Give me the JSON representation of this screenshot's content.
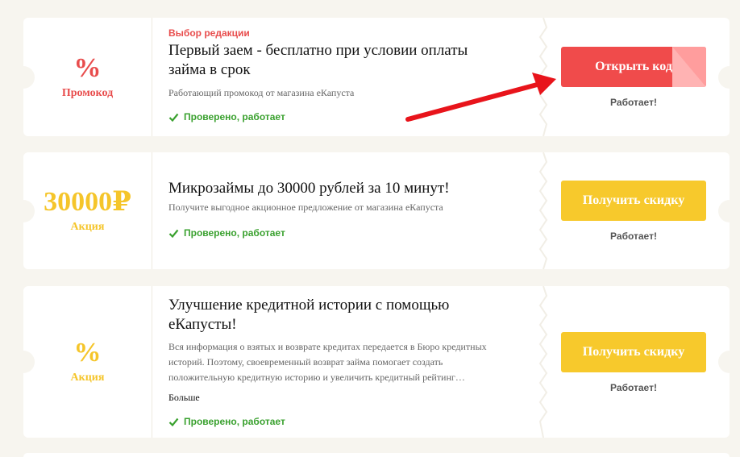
{
  "coupons": [
    {
      "value": "%",
      "kind": "Промокод",
      "badge": "Выбор редакции",
      "title_line1": "Первый заем - бесплатно при условии оплаты",
      "title_line2": "займа в срок",
      "description": "Работающий промокод от магазина еКапуста",
      "verified": "Проверено, работает",
      "button": "Открыть код",
      "status": "Работает!"
    },
    {
      "value": "30000₽",
      "kind": "Акция",
      "title_line1": "Микрозаймы до 30000 рублей за 10 минут!",
      "description": "Получите выгодное акционное предложение от магазина еКапуста",
      "verified": "Проверено, работает",
      "button": "Получить скидку",
      "status": "Работает!"
    },
    {
      "value": "%",
      "kind": "Акция",
      "title_line1": "Улучшение кредитной истории с помощью",
      "title_line2": "еКапусты!",
      "desc_line1": "Вся информация о взятых и возврате кредитах передается в Бюро кредитных",
      "desc_line2": "историй. Поэтому, своевременный возврат займа помогает создать",
      "desc_line3": "положительную кредитную историю и увеличить кредитный рейтинг…",
      "more": "Больше",
      "verified": "Проверено, работает",
      "button": "Получить скидку",
      "status": "Работает!"
    }
  ],
  "colors": {
    "promo_red": "#e84d4d",
    "promo_yellow": "#f5c52a",
    "verified_green": "#3aa12f",
    "arrow_red": "#e8141b"
  },
  "icons": [
    "check-icon",
    "arrow-annotation"
  ]
}
